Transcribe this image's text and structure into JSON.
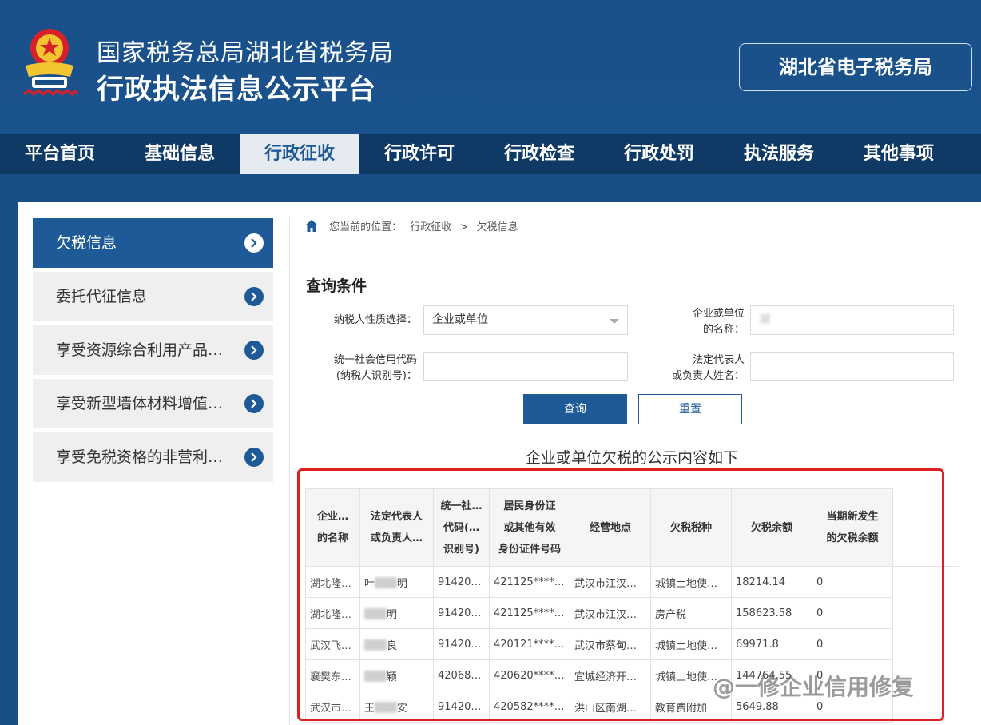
{
  "header": {
    "line1": "国家税务总局湖北省税务局",
    "line2": "行政执法信息公示平台",
    "etax_button": "湖北省电子税务局",
    "emblem_icon": "tax-emblem-icon"
  },
  "nav": {
    "items": [
      {
        "label": "平台首页",
        "active": false
      },
      {
        "label": "基础信息",
        "active": false
      },
      {
        "label": "行政征收",
        "active": true
      },
      {
        "label": "行政许可",
        "active": false
      },
      {
        "label": "行政检查",
        "active": false
      },
      {
        "label": "行政处罚",
        "active": false
      },
      {
        "label": "执法服务",
        "active": false
      },
      {
        "label": "其他事项",
        "active": false
      }
    ]
  },
  "sidebar": {
    "items": [
      {
        "label": "欠税信息",
        "active": true
      },
      {
        "label": "委托代征信息",
        "active": false
      },
      {
        "label": "享受资源综合利用产品…",
        "active": false
      },
      {
        "label": "享受新型墙体材料增值…",
        "active": false
      },
      {
        "label": "享受免税资格的非营利…",
        "active": false
      }
    ]
  },
  "breadcrumb": {
    "prefix": "您当前的位置：",
    "level1": "行政征收",
    "sep": ">",
    "level2": "欠税信息"
  },
  "query": {
    "title": "查询条件",
    "taxpayer_type_label": "纳税人性质选择：",
    "taxpayer_type_value": "企业或单位",
    "name_label_1": "企业或单位",
    "name_label_2": "的名称：",
    "name_value": "湖",
    "credit_code_label_1": "统一社会信用代码",
    "credit_code_label_2": "(纳税人识别号)：",
    "legal_rep_label_1": "法定代表人",
    "legal_rep_label_2": "或负责人姓名：",
    "search_button": "查询",
    "reset_button": "重置"
  },
  "results": {
    "caption": "企业或单位欠税的公示内容如下",
    "columns": [
      [
        "企业…",
        "的名称"
      ],
      [
        "法定代表人",
        "或负责人…"
      ],
      [
        "统一社…",
        "代码(…",
        "识别号)"
      ],
      [
        "居民身份证",
        "或其他有效",
        "身份证件号码"
      ],
      [
        "经营地点"
      ],
      [
        "欠税税种"
      ],
      [
        "欠税余额"
      ],
      [
        "当期新发生",
        "的欠税余额"
      ]
    ],
    "rows": [
      [
        "湖北隆…",
        "叶",
        "91420…",
        "421125****…",
        "武汉市江汉…",
        "城镇土地使…",
        "18214.14",
        "0"
      ],
      [
        "湖北隆…",
        "",
        "91420…",
        "421125****…",
        "武汉市江汉…",
        "房产税",
        "158623.58",
        "0"
      ],
      [
        "武汉飞…",
        "",
        "91420…",
        "420121****…",
        "武汉市蔡甸…",
        "城镇土地使…",
        "69971.8",
        "0"
      ],
      [
        "襄樊东…",
        "",
        "42068…",
        "420620****…",
        "宜城经济开…",
        "城镇土地使…",
        "144764.55",
        "0"
      ],
      [
        "武汉市…",
        "王",
        "91420…",
        "420582****…",
        "洪山区南湖…",
        "教育费附加",
        "5649.88",
        "0"
      ]
    ]
  },
  "watermark": "@一修企业信用修复",
  "colors": {
    "brand_blue": "#1a4f86",
    "nav_dark": "#0f3a66",
    "active_blue": "#1d5a97",
    "highlight_red": "#e02020"
  }
}
